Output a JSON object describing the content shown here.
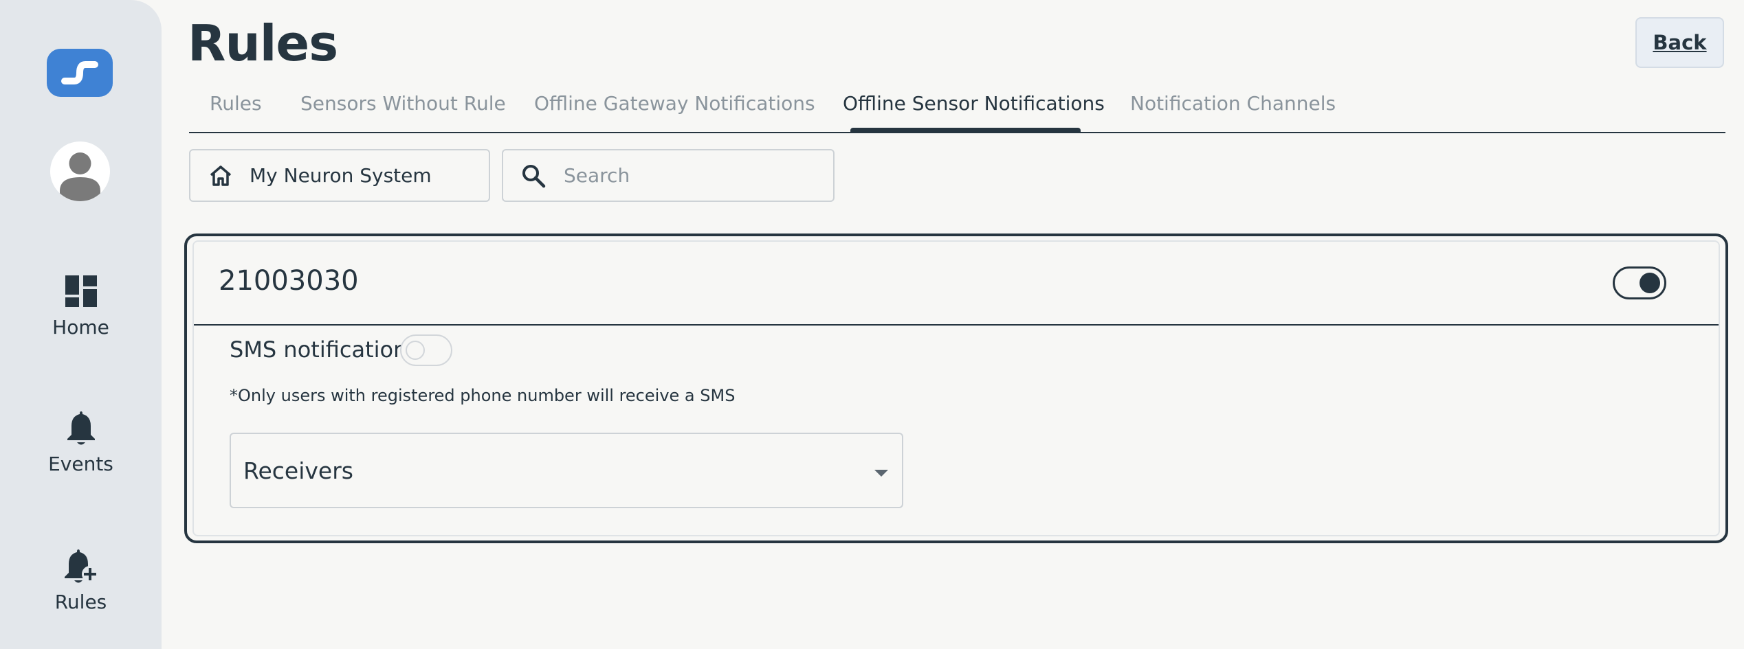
{
  "sidebar": {
    "logo_icon": "link-logo-icon",
    "avatar_icon": "user-avatar-icon",
    "items": [
      {
        "label": "Home",
        "icon": "dashboard-icon"
      },
      {
        "label": "Events",
        "icon": "bell-icon"
      },
      {
        "label": "Rules",
        "icon": "bell-plus-icon"
      }
    ]
  },
  "header": {
    "title": "Rules",
    "back_label": "Back"
  },
  "tabs": [
    {
      "label": "Rules",
      "active": false
    },
    {
      "label": "Sensors Without Rule",
      "active": false
    },
    {
      "label": "Offline Gateway Notifications",
      "active": false
    },
    {
      "label": "Offline Sensor Notifications",
      "active": true
    },
    {
      "label": "Notification Channels",
      "active": false
    }
  ],
  "filters": {
    "location_label": "My Neuron System",
    "location_icon": "home-icon",
    "search_placeholder": "Search",
    "search_value": "",
    "search_icon": "search-icon"
  },
  "card": {
    "sensor_id": "21003030",
    "enabled": true,
    "sms_label": "SMS notification",
    "sms_enabled": false,
    "sms_note": "*Only users with registered phone number will receive a SMS",
    "receivers_label": "Receivers"
  },
  "colors": {
    "primary": "#263540",
    "accent": "#3f82d4",
    "sidebar_bg": "#e3e7eb",
    "page_bg": "#f7f7f5",
    "muted_text": "#8a949c"
  }
}
